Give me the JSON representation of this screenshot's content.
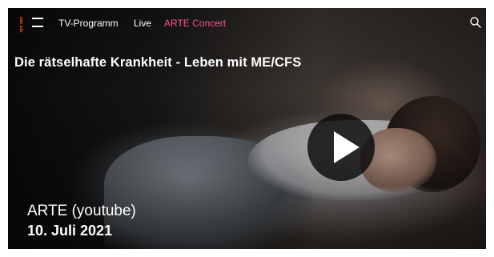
{
  "nav": {
    "logo_text": "arte",
    "menu_icon": "hamburger-icon",
    "links": [
      "TV-Programm",
      "Live",
      "ARTE Concert"
    ],
    "search_icon": "search-icon",
    "accent_color": "#fd4e92",
    "logo_color": "#fa481c"
  },
  "video": {
    "title": "Die rätselhafte Krankheit - Leben mit ME/CFS",
    "play_icon": "play-icon"
  },
  "caption": {
    "channel": "ARTE (youtube)",
    "date": "10. Juli 2021"
  }
}
